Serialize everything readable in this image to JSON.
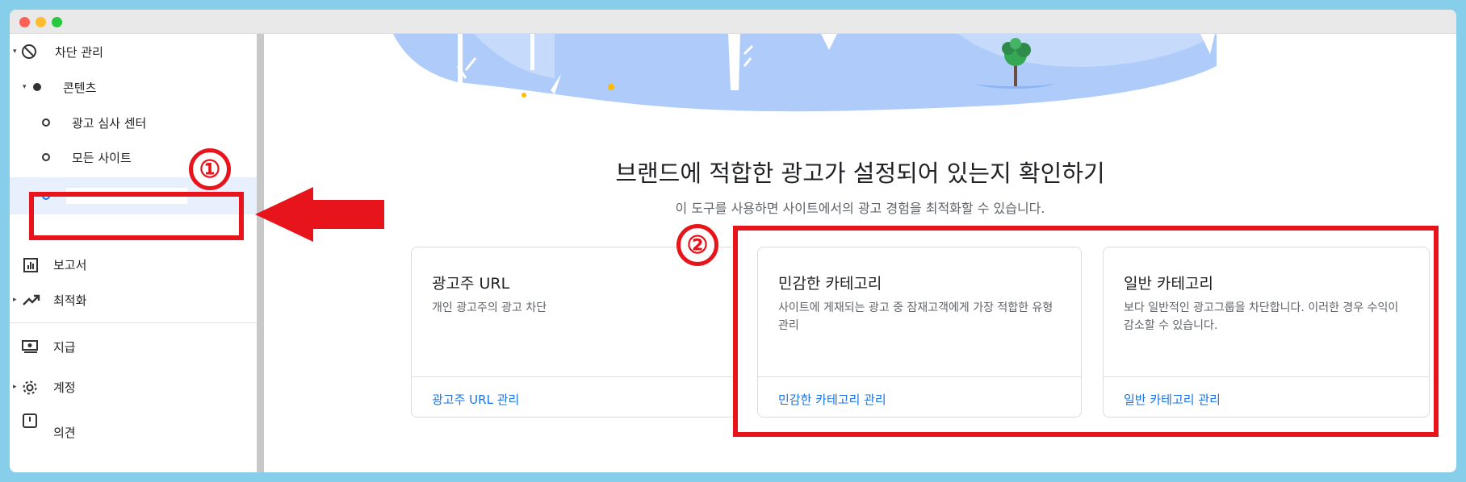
{
  "sidebar": {
    "items": [
      {
        "label": "차단 관리",
        "icon": "block-icon"
      },
      {
        "label": "콘텐츠"
      },
      {
        "label": "광고 심사 센터"
      },
      {
        "label": "모든 사이트"
      },
      {
        "label": ""
      },
      {
        "label": "보고서",
        "icon": "report-chart-icon"
      },
      {
        "label": "최적화",
        "icon": "trending-up-icon"
      },
      {
        "label": "지급",
        "icon": "payments-icon"
      },
      {
        "label": "계정",
        "icon": "gear-icon"
      },
      {
        "label": "의견",
        "icon": "feedback-icon"
      }
    ]
  },
  "main": {
    "headline": "브랜드에 적합한 광고가 설정되어 있는지 확인하기",
    "subline": "이 도구를 사용하면 사이트에서의 광고 경험을 최적화할 수 있습니다.",
    "cards": [
      {
        "title": "광고주 URL",
        "desc": "개인 광고주의 광고 차단",
        "link": "광고주 URL 관리"
      },
      {
        "title": "민감한 카테고리",
        "desc": "사이트에 게재되는 광고 중 잠재고객에게 가장 적합한 유형 관리",
        "link": "민감한 카테고리 관리"
      },
      {
        "title": "일반 카테고리",
        "desc": "보다 일반적인 광고그룹을 차단합니다. 이러한 경우 수익이 감소할 수 있습니다.",
        "link": "일반 카테고리 관리"
      }
    ]
  },
  "annotations": {
    "marker1": "①",
    "marker2": "②",
    "color": "#e8141c"
  },
  "colors": {
    "accent": "#1a73e8",
    "background": "#87ceeb",
    "illustration": "#aecbfa"
  }
}
